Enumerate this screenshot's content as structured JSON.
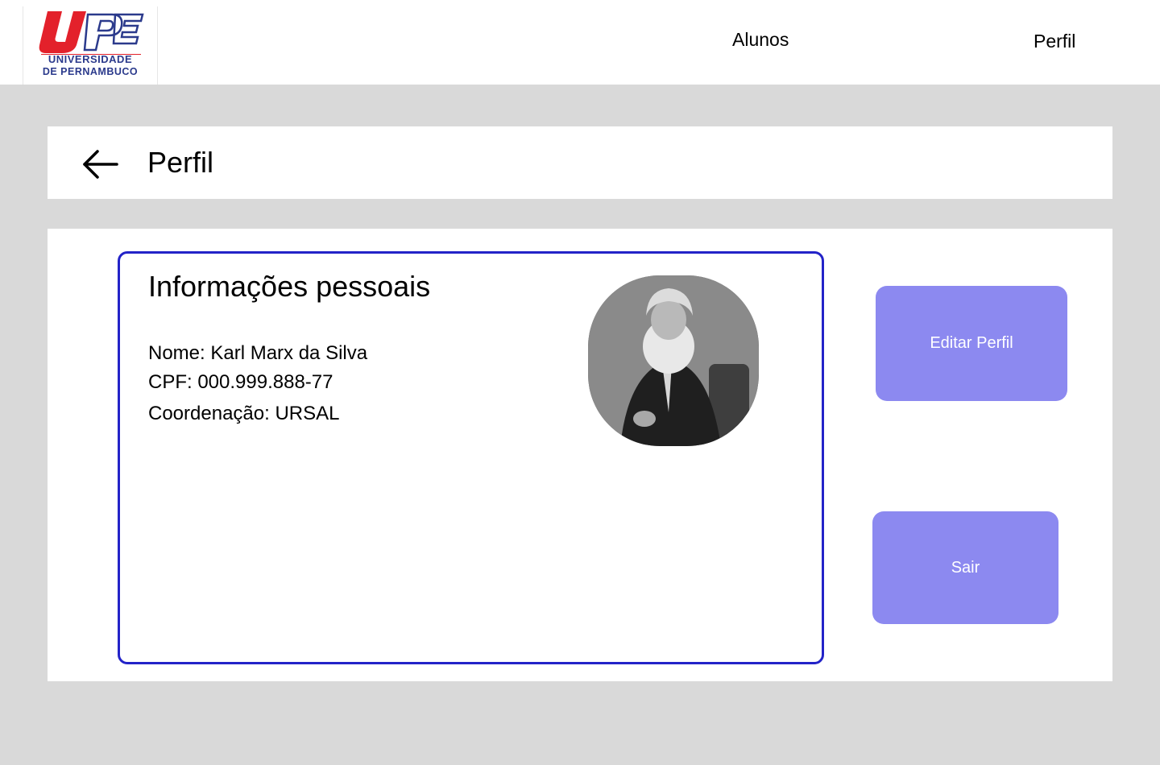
{
  "header": {
    "logo": {
      "mark": "UPE",
      "line1": "UNIVERSIDADE",
      "line2": "DE PERNAMBUCO",
      "colors": {
        "red": "#e3212b",
        "blue": "#2b3a8c"
      }
    },
    "nav": [
      {
        "label": "Alunos"
      },
      {
        "label": "Perfil"
      }
    ]
  },
  "page": {
    "title": "Perfil",
    "back_icon": "arrow-left-icon"
  },
  "info": {
    "title": "Informações pessoais",
    "lines": [
      "Nome: Karl Marx da Silva",
      "CPF: 000.999.888-77",
      "Coordenação: URSAL"
    ]
  },
  "actions": {
    "edit_label": "Editar Perfil",
    "exit_label": "Sair"
  },
  "colors": {
    "background": "#d9d9d9",
    "card_border": "#2323c8",
    "button": "#8c89f0"
  }
}
